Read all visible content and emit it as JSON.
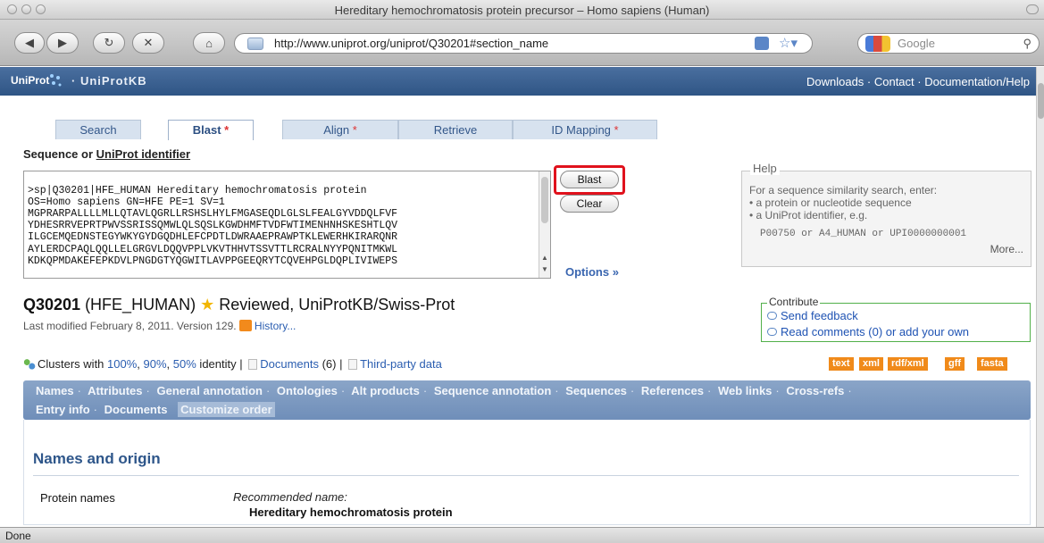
{
  "browser": {
    "window_title": "Hereditary hemochromatosis protein precursor – Homo sapiens (Human)",
    "url": "http://www.uniprot.org/uniprot/Q30201#section_name",
    "search_placeholder": "Google",
    "status": "Done"
  },
  "uniprot_header": {
    "logo": "UniProt",
    "product": "· UniProtKB",
    "links": "Downloads · Contact · Documentation/Help"
  },
  "tabs": [
    {
      "label": "Search",
      "mark": ""
    },
    {
      "label": "Blast",
      "mark": " *"
    },
    {
      "label": "Align",
      "mark": " *"
    },
    {
      "label": "Retrieve",
      "mark": ""
    },
    {
      "label": "ID Mapping",
      "mark": " *"
    }
  ],
  "sequence": {
    "label_prefix": "Sequence or ",
    "label_link": "UniProt identifier",
    "lines": [
      ">sp|Q30201|HFE_HUMAN Hereditary hemochromatosis protein",
      "OS=Homo sapiens GN=HFE PE=1 SV=1",
      "MGPRARPALLLLMLLQTAVLQGRLLRSHSLHYLFMGASEQDLGLSLFEALGYVDDQLFVF",
      "YDHESRRVEPRTPWVSSRISSQMWLQLSQSLKGWDHMFTVDFWTIMENHNHSKESHTLQV",
      "ILGCEMQEDNSTEGYWKYGYDGQDHLEFCPDTLDWRAAEPRAWPTKLEWERHKIRARQNR",
      "AYLERDCPAQLQQLLELGRGVLDQQVPPLVKVTHHVTSSVTTLRCRALNYYPQNITMKWL",
      "KDKQPMDAKEFEPKDVLPNGDGTYQGWITLAVPPGEEQRYTCQVEHPGLDQPLIVIWEPS"
    ],
    "blast_label": "Blast",
    "clear_label": "Clear",
    "options_label": "Options »"
  },
  "help": {
    "title": "Help",
    "line1": "For a sequence similarity search, enter:",
    "line2": "• a protein or nucleotide sequence",
    "line3": "• a UniProt identifier, e.g.",
    "ids": "P00750 or A4_HUMAN or UPI0000000001",
    "more": "More..."
  },
  "entry": {
    "accession": "Q30201",
    "name": " (HFE_HUMAN) ",
    "status": " Reviewed, UniProtKB/Swiss-Prot",
    "modified": "Last modified February 8, 2011. Version 129. ",
    "history": "History..."
  },
  "contribute": {
    "title": "Contribute",
    "feedback": "Send feedback",
    "comments": "Read comments (0) or add your own"
  },
  "clusters": {
    "prefix": "Clusters with ",
    "c100": "100%",
    "c90": "90%",
    "c50": "50%",
    "suffix": " identity | ",
    "documents": "Documents",
    "doc_count": " (6) | ",
    "third_party": "Third-party data"
  },
  "formats": [
    "text",
    "xml",
    "rdf/xml",
    "gff",
    "fasta"
  ],
  "section_nav": {
    "row1": [
      "Names",
      "Attributes",
      "General annotation",
      "Ontologies",
      "Alt products",
      "Sequence annotation",
      "Sequences",
      "References",
      "Web links",
      "Cross-refs"
    ],
    "row2": [
      "Entry info",
      "Documents"
    ],
    "customize": "Customize order"
  },
  "names_section": {
    "heading": "Names and origin",
    "protein_names_label": "Protein names",
    "recommended_label": "Recommended name:",
    "recommended_value": "Hereditary hemochromatosis protein"
  },
  "colors": {
    "header_blue": "#2f5585",
    "nav_blue": "#7b98c0",
    "highlight_red": "#e0121d",
    "format_orange": "#f08a1a",
    "contribute_green": "#52b04a"
  }
}
